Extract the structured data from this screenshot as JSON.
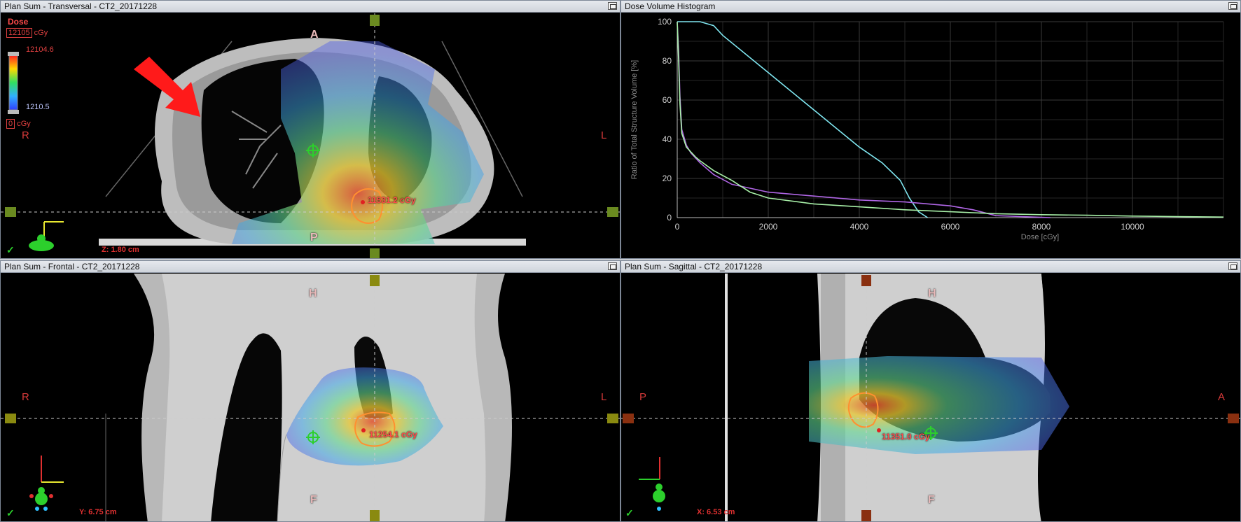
{
  "panes": {
    "transversal": {
      "title": "Plan Sum - Transversal - CT2_20171228",
      "top": "A",
      "bottom": "P",
      "left": "R",
      "right": "L",
      "slice": "Z: 1.80 cm",
      "dose_label": "11531.2 cGy"
    },
    "dvh": {
      "title": "Dose Volume Histogram"
    },
    "frontal": {
      "title": "Plan Sum - Frontal - CT2_20171228",
      "top": "H",
      "bottom": "F",
      "left": "R",
      "right": "L",
      "slice": "Y: 6.75 cm",
      "dose_label": "11254.1 cGy"
    },
    "sagittal": {
      "title": "Plan Sum - Sagittal - CT2_20171228",
      "top": "H",
      "bottom": "F",
      "left": "P",
      "right": "A",
      "slice": "X: 6.53 cm",
      "dose_label": "11351.0 cGy"
    }
  },
  "dose_legend": {
    "title": "Dose",
    "max_box": "12105",
    "unit": "cGy",
    "max_value": "12104.6",
    "min_value": "1210.5",
    "min_box": "0",
    "min_unit": "cGy"
  },
  "check_mark": "✓",
  "colors": {
    "accent_red": "#e03030",
    "crosshair_green": "#2ccf2c"
  },
  "chart_data": {
    "type": "line",
    "title": "",
    "xlabel": "Dose [cGy]",
    "ylabel": "Ratio of Total Structure Volume [%]",
    "xlim": [
      0,
      12000
    ],
    "ylim": [
      0,
      100
    ],
    "xticks": [
      0,
      2000,
      4000,
      6000,
      8000,
      10000
    ],
    "yticks": [
      0,
      20,
      40,
      60,
      80,
      100
    ],
    "grid": true,
    "series": [
      {
        "color": "#7fe6f0",
        "x": [
          0,
          50,
          100,
          500,
          800,
          1000,
          2000,
          3000,
          4000,
          4500,
          4900,
          5100,
          5300,
          5500
        ],
        "y": [
          100,
          100,
          100,
          100,
          98,
          93,
          74,
          55,
          36,
          28,
          19,
          10,
          3,
          0
        ]
      },
      {
        "color": "#b066e6",
        "x": [
          0,
          30,
          60,
          100,
          200,
          300,
          500,
          800,
          1200,
          2000,
          3000,
          4000,
          5000,
          6000,
          6500,
          7000,
          8200
        ],
        "y": [
          100,
          85,
          62,
          45,
          37,
          33,
          28,
          22,
          17,
          13,
          11,
          9,
          8,
          6,
          4,
          1,
          0
        ]
      },
      {
        "color": "#a8f0a8",
        "x": [
          0,
          30,
          60,
          100,
          200,
          400,
          500,
          800,
          1200,
          1600,
          2000,
          3000,
          4000,
          5000,
          6000,
          7000,
          8000,
          9000,
          10000,
          11000,
          12000
        ],
        "y": [
          100,
          80,
          58,
          43,
          36,
          31,
          29,
          24,
          19,
          13,
          10,
          7,
          5.5,
          4,
          3,
          2,
          1.5,
          1.2,
          0.8,
          0.5,
          0.3
        ]
      }
    ]
  }
}
